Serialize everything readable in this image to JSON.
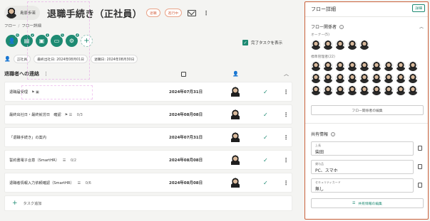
{
  "header": {
    "user_name": "島原歩茉",
    "title": "退職手続き（正社員）",
    "badges": [
      "退職",
      "進行中"
    ]
  },
  "breadcrumb": [
    "フロー",
    "フロー詳細"
  ],
  "assignee_counts": [
    "6",
    "2",
    "1",
    "5",
    "4"
  ],
  "show_completed_label": "完了タスクを表示",
  "meta_chips": [
    "正社員",
    "最終出社日: 2024年08月01日",
    "退職日: 2024年08月30日"
  ],
  "section_title": "退職者への連絡",
  "tasks": [
    {
      "name": "退職届受理",
      "extra": "",
      "date": "2024年07月31日"
    },
    {
      "name": "最終出社日・最終就労日　確認",
      "extra": "0/3",
      "date": "2024年08月08日"
    },
    {
      "name": "「退職手続き」の案内",
      "extra": "",
      "date": "2024年07月31日"
    },
    {
      "name": "誓約書電子合意（SmartHR）",
      "extra": "0/2",
      "date": "2024年08月08日"
    },
    {
      "name": "退職者情報入力依頼確認（SmartHR）",
      "extra": "0/6",
      "date": "2024年08月08日"
    }
  ],
  "add_task_label": "タスク追加",
  "panel": {
    "title": "フロー詳細",
    "detail_button": "詳細",
    "people_title": "フロー関係者",
    "owner_label": "オーナー(5)",
    "members_label": "標準管理者(22)",
    "edit_people_button": "フロー関係者の編集",
    "shared_title": "共有情報",
    "fields": [
      {
        "label": "上長",
        "value": "柴田"
      },
      {
        "label": "貸与品",
        "value": "PC、スマホ"
      },
      {
        "label": "セキュリティカード",
        "value": "無し"
      }
    ],
    "edit_shared_button": "共有情報の編集"
  },
  "colors": {
    "accent": "#1d8a72",
    "panel_border": "#c9603a"
  }
}
